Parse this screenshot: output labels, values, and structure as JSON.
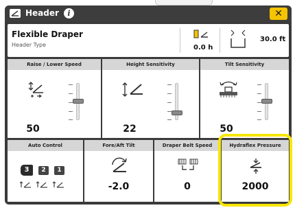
{
  "window": {
    "title": "Header",
    "info_icon": "info-icon",
    "close_icon": "close-icon",
    "accent": "#f5c400",
    "highlight_color": "#f7e600"
  },
  "header": {
    "name": "Flexible Draper",
    "type_label": "Header Type",
    "height_value": "0.0 h",
    "width_value": "30.0 ft"
  },
  "tiles": {
    "raise_lower": {
      "label": "Raise / Lower Speed",
      "value": "50"
    },
    "height_sensitivity": {
      "label": "Height Sensitivity",
      "value": "22"
    },
    "tilt_sensitivity": {
      "label": "Tilt Sensitivity",
      "value": "50"
    },
    "auto_control": {
      "label": "Auto Control",
      "buttons": [
        "3",
        "2",
        "1"
      ]
    },
    "fore_aft_tilt": {
      "label": "Fore/Aft Tilt",
      "value": "-2.0"
    },
    "draper_belt_speed": {
      "label": "Draper Belt Speed",
      "value": "0"
    },
    "hydraflex_pressure": {
      "label": "Hydraflex Pressure",
      "value": "2000"
    }
  }
}
